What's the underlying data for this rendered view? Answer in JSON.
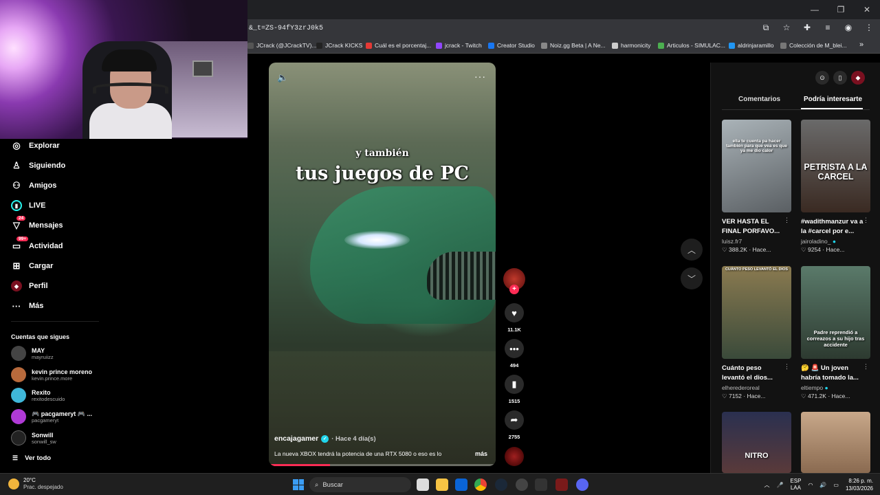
{
  "browser": {
    "url": "&_t=ZS-94fY3zrJ0k5",
    "bookmarks": [
      "JCrack (@JCrackTV)...",
      "JCrack KICKS",
      "Cuál es el porcentaj...",
      "jcrack - Twitch",
      "Creator Studio",
      "Noiz.gg Beta | A Ne...",
      "harmonicity",
      "Articulos - SIMULAC...",
      "aldrinjaramillo",
      "Colección de M_blei..."
    ],
    "bookmark_colors": [
      "#555",
      "#222",
      "#e53935",
      "#9146ff",
      "#1877f2",
      "#888",
      "#ccc",
      "#4caf50",
      "#2196f3",
      "#777"
    ],
    "overflow": "»"
  },
  "sidebar": {
    "items": [
      {
        "label": "Explorar",
        "icon": "compass-icon"
      },
      {
        "label": "Siguiendo",
        "icon": "user-follow-icon"
      },
      {
        "label": "Amigos",
        "icon": "friends-icon"
      },
      {
        "label": "LIVE",
        "icon": "live-icon"
      },
      {
        "label": "Mensajes",
        "icon": "message-icon",
        "badge": "24"
      },
      {
        "label": "Actividad",
        "icon": "activity-icon",
        "badge": "99+"
      },
      {
        "label": "Cargar",
        "icon": "upload-icon"
      },
      {
        "label": "Perfil",
        "icon": "profile-icon"
      },
      {
        "label": "Más",
        "icon": "more-icon"
      }
    ],
    "following_title": "Cuentas que sigues",
    "accounts": [
      {
        "name": "MAY",
        "handle": "mayruiizz",
        "color": "#444"
      },
      {
        "name": "kevin prince moreno",
        "handle": "kevin.prince.more",
        "color": "#b86a3c"
      },
      {
        "name": "Rexito",
        "handle": "rexitodescuido",
        "color": "#3fb7d9"
      },
      {
        "name": "🎮 pacgameryt 🎮 ...",
        "handle": "pacgameryt",
        "color": "#b03ad6"
      },
      {
        "name": "Sonwill",
        "handle": "sonwill_sw",
        "color": "#222"
      }
    ],
    "see_all": "Ver todo"
  },
  "video": {
    "subtitle_small": "y también",
    "subtitle_big": "tus juegos de PC",
    "author": "encajagamer",
    "ago": "· Hace 4 día(s)",
    "description": "La nueva XBOX tendrá la potencia de una RTX 5080 o eso es lo",
    "more": "más",
    "progress": 0.27
  },
  "actions": {
    "likes": "11.1K",
    "comments": "494",
    "saves": "1515",
    "shares": "2755"
  },
  "right_panel": {
    "tab_comments": "Comentarios",
    "tab_interest": "Podría interesarte",
    "cards": [
      {
        "title": "VER HASTA EL FINAL PORFAVO...",
        "author": "luisz.fr7",
        "verified": false,
        "views": "388.2K",
        "ago": "Hace...",
        "thumb_text": "ella te cuenta pa hacer también para que vea es que ya me dio calor",
        "bg": "#8a8f94"
      },
      {
        "title": "#wadithmanzur va a la #carcel por e...",
        "author": "jairoladino_",
        "verified": true,
        "views": "9254",
        "ago": "Hace...",
        "thumb_text": "PETRISTA A LA CARCEL",
        "bg": "#4a3a30"
      },
      {
        "title": "Cuánto peso levantó el dios...",
        "author": "elherederoreal",
        "verified": false,
        "views": "7152",
        "ago": "Hace...",
        "thumb_text": "CUÁNTO PESO LEVANTÓ EL DIOS",
        "bg": "#6a5a3a"
      },
      {
        "title": "🤔 🚨 Un joven habría tomado la...",
        "author": "eltiempo",
        "verified": true,
        "views": "471.2K",
        "ago": "Hace...",
        "thumb_text": "Padre reprendió a correazos a su hijo tras accidente",
        "bg": "#3d5a4a"
      },
      {
        "title": "",
        "author": "",
        "verified": false,
        "views": "",
        "ago": "",
        "thumb_text": "NITRO",
        "bg": "#3a3f50"
      },
      {
        "title": "",
        "author": "",
        "verified": false,
        "views": "",
        "ago": "",
        "thumb_text": "",
        "bg": "#b89a80"
      }
    ]
  },
  "taskbar": {
    "temp": "20°C",
    "weather": "Prac. despejado",
    "search": "Buscar",
    "lang1": "ESP",
    "lang2": "LAA",
    "time": "8:26 p. m.",
    "date": "13/03/2026"
  }
}
